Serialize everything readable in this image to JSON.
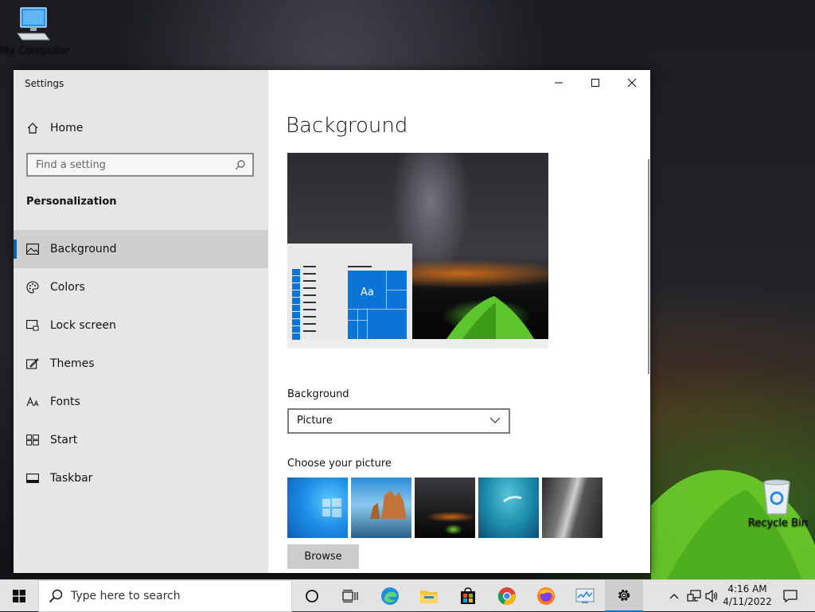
{
  "desktop": {
    "icons": [
      {
        "label": "My Computer"
      },
      {
        "label": "Recycle Bin"
      }
    ]
  },
  "window": {
    "title": "Settings",
    "controls": {
      "minimize": "minimize",
      "maximize": "maximize",
      "close": "close"
    },
    "sidebar": {
      "home": "Home",
      "search_placeholder": "Find a setting",
      "section_heading": "Personalization",
      "items": [
        {
          "label": "Background",
          "icon": "picture-icon",
          "active": true
        },
        {
          "label": "Colors",
          "icon": "palette-icon"
        },
        {
          "label": "Lock screen",
          "icon": "lock-screen-icon"
        },
        {
          "label": "Themes",
          "icon": "themes-icon"
        },
        {
          "label": "Fonts",
          "icon": "fonts-icon"
        },
        {
          "label": "Start",
          "icon": "start-icon"
        },
        {
          "label": "Taskbar",
          "icon": "taskbar-icon"
        }
      ]
    },
    "content": {
      "page_title": "Background",
      "preview_tile_text": "Aa",
      "background_label": "Background",
      "background_value": "Picture",
      "choose_label": "Choose your picture",
      "browse_label": "Browse"
    }
  },
  "taskbar": {
    "search_placeholder": "Type here to search",
    "time": "4:16 AM",
    "date": "4/11/2022",
    "accent": "#0078d7"
  }
}
